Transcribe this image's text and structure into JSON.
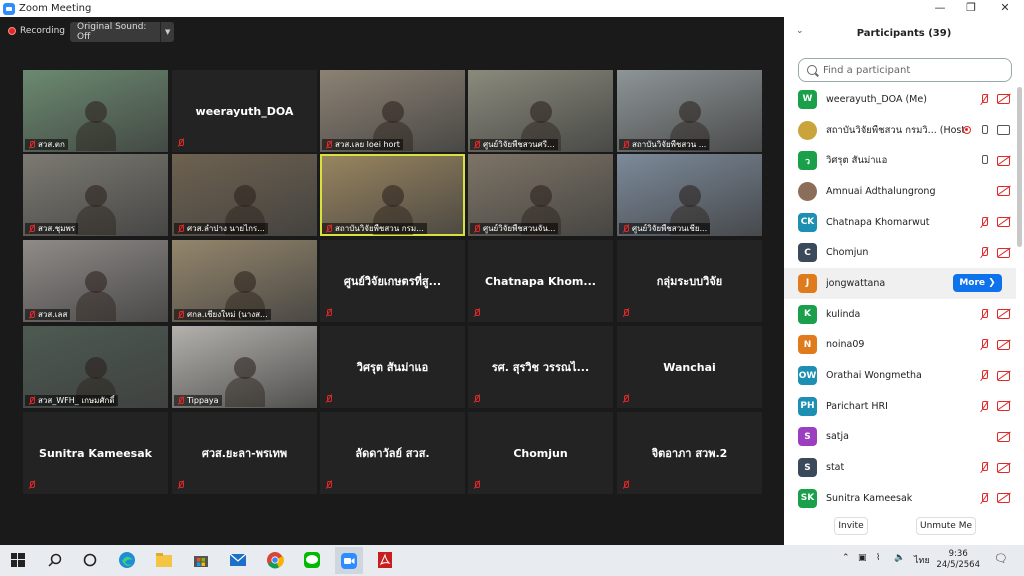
{
  "window": {
    "title": "Zoom Meeting",
    "minimize": "—",
    "maximize": "❐",
    "close": "✕"
  },
  "toolbar": {
    "recording": "Recording",
    "original_sound": "Original Sound: Off"
  },
  "tiles": [
    {
      "caption": "สวส.ตก",
      "video": true,
      "color": "#6b8a70"
    },
    {
      "name": "weerayuth_DOA",
      "video": false
    },
    {
      "caption": "สวส.เลย loei hort",
      "video": true,
      "color": "#8c8274"
    },
    {
      "caption": "ศูนย์วิจัยพืชสวนศรี...",
      "video": true,
      "color": "#8a8a7c"
    },
    {
      "caption": "สถาบันวิจัยพืชสวน ...",
      "video": true,
      "color": "#8e9597"
    },
    {
      "caption": "สวส.ชุมพร",
      "video": true,
      "color": "#7c7a72"
    },
    {
      "caption": "ศวส.ลำปาง นายไกร...",
      "video": true,
      "color": "#6e6250"
    },
    {
      "caption": "สถาบันวิจัยพืชสวน กรม...",
      "video": true,
      "color": "#9a8660",
      "active": true
    },
    {
      "caption": "ศูนย์วิจัยพืชสวนจัน...",
      "video": true,
      "color": "#7d7466"
    },
    {
      "caption": "ศูนย์วิจัยพืชสวนเชีย...",
      "video": true,
      "color": "#7c8a9a"
    },
    {
      "caption": "สวส.เลส",
      "video": true,
      "color": "#8f8b88"
    },
    {
      "caption": "ศกล.เชียงใหม่ (นางส...",
      "video": true,
      "color": "#94866c"
    },
    {
      "name": "ศูนย์วิจัยเกษตรที่สู...",
      "video": false
    },
    {
      "name": "Chatnapa  Khom...",
      "video": false
    },
    {
      "name": "กลุ่มระบบวิจัย",
      "video": false
    },
    {
      "caption": "สวส_WFH_ เกษมศักดิ์",
      "video": true,
      "color": "#4d5a52"
    },
    {
      "caption": "Tippaya",
      "video": true,
      "color": "#b3b1ac"
    },
    {
      "name": "วิศรุต สันม่าแอ",
      "video": false
    },
    {
      "name": "รศ. สุรวิช  วรรณไ...",
      "video": false
    },
    {
      "name": "Wanchai",
      "video": false
    },
    {
      "name": "Sunitra Kameesak",
      "video": false
    },
    {
      "name": "ศวส.ยะลา-พรเทพ",
      "video": false
    },
    {
      "name": "ลัดดาวัลย์  สวส.",
      "video": false
    },
    {
      "name": "Chomjun",
      "video": false
    },
    {
      "name": "จิตอาภา สวพ.2",
      "video": false
    }
  ],
  "panel": {
    "title": "Participants (39)",
    "search_placeholder": "Find a participant",
    "more_label": "More ❯",
    "invite": "Invite",
    "unmute_me": "Unmute Me",
    "participants": [
      {
        "initials": "W",
        "name": "weerayuth_DOA (Me)",
        "color": "#1aa04a",
        "mic": "off",
        "video": "off"
      },
      {
        "initials": "",
        "name": "สถาบันวิจัยพืชสวน กรมวิ... (Host)",
        "color": "#c9a43a",
        "mic": "on",
        "video": "on",
        "rec": true
      },
      {
        "initials": "ว",
        "name": "วิศรุต สันม่าแอ",
        "color": "#1aa04a",
        "mic": "on",
        "video": "off"
      },
      {
        "initials": "",
        "name": "Amnuai Adthalungrong",
        "color": "#8a6e5a",
        "mic": "none",
        "video": "off"
      },
      {
        "initials": "CK",
        "name": "Chatnapa Khomarwut",
        "color": "#1d8fb3",
        "mic": "off",
        "video": "off"
      },
      {
        "initials": "C",
        "name": "Chomjun",
        "color": "#3a4a5a",
        "mic": "off",
        "video": "off"
      },
      {
        "initials": "J",
        "name": "jongwattana",
        "color": "#e07b1d",
        "mic": "none",
        "video": "none",
        "hover": true
      },
      {
        "initials": "K",
        "name": "kulinda",
        "color": "#1aa04a",
        "mic": "off",
        "video": "off"
      },
      {
        "initials": "N",
        "name": "noina09",
        "color": "#e07b1d",
        "mic": "off",
        "video": "off"
      },
      {
        "initials": "OW",
        "name": "Orathai Wongmetha",
        "color": "#1d8fb3",
        "mic": "off",
        "video": "off"
      },
      {
        "initials": "PH",
        "name": "Parichart HRI",
        "color": "#1d8fb3",
        "mic": "off",
        "video": "off"
      },
      {
        "initials": "S",
        "name": "satja",
        "color": "#9b3fc0",
        "mic": "none",
        "video": "off"
      },
      {
        "initials": "S",
        "name": "stat",
        "color": "#3a4a5a",
        "mic": "off",
        "video": "off"
      },
      {
        "initials": "SK",
        "name": "Sunitra Kameesak",
        "color": "#1aa04a",
        "mic": "off",
        "video": "off"
      }
    ]
  },
  "taskbar": {
    "time": "9:36",
    "date": "24/5/2564",
    "lang": "ไทย",
    "icons": [
      "windows-icon",
      "search-icon",
      "cortana-icon",
      "edge-icon",
      "file-explorer-icon",
      "store-icon",
      "mail-icon",
      "chrome-icon",
      "line-icon",
      "zoom-icon",
      "acrobat-icon"
    ]
  }
}
